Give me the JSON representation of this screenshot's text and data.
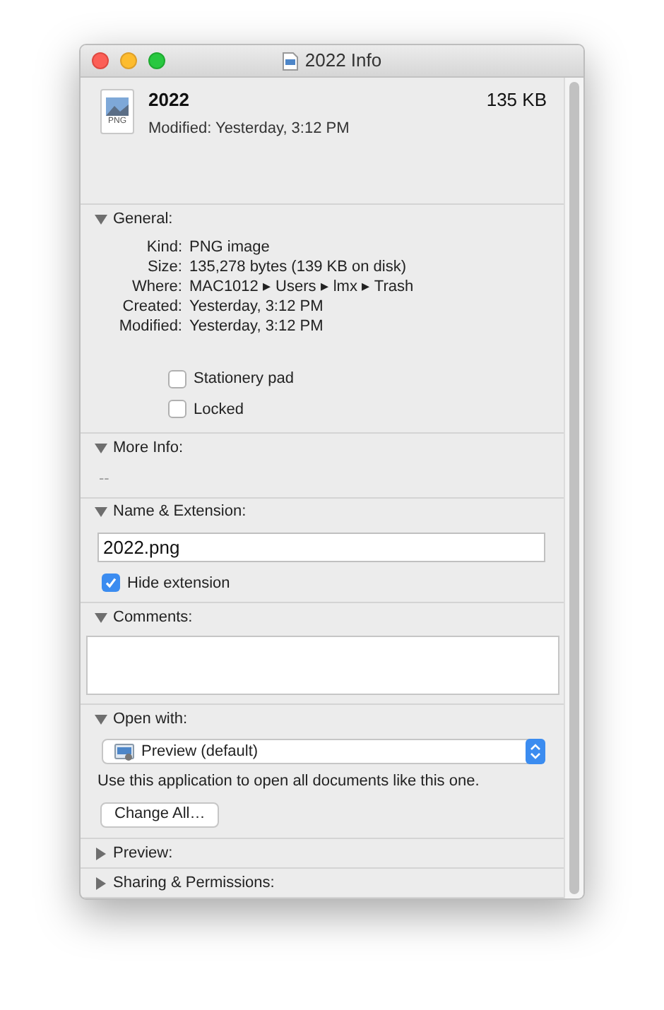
{
  "window": {
    "title": "2022 Info"
  },
  "header": {
    "icon_label": "PNG",
    "name": "2022",
    "size": "135 KB",
    "modified": "Modified: Yesterday, 3:12 PM"
  },
  "sections": [
    {
      "kind": "general",
      "title": "General:",
      "expanded": true,
      "fields": [
        {
          "label": "Kind:",
          "value": "PNG image"
        },
        {
          "label": "Size:",
          "value": "135,278 bytes (139 KB on disk)"
        },
        {
          "label": "Where:",
          "value": "MAC1012 ▸ Users ▸ lmx ▸ Trash"
        },
        {
          "label": "Created:",
          "value": "Yesterday, 3:12 PM"
        },
        {
          "label": "Modified:",
          "value": "Yesterday, 3:12 PM"
        }
      ],
      "checkboxes": [
        {
          "label": "Stationery pad",
          "checked": false
        },
        {
          "label": "Locked",
          "checked": false
        }
      ]
    },
    {
      "kind": "more_info",
      "title": "More Info:",
      "expanded": true,
      "value": "--"
    },
    {
      "kind": "name",
      "title": "Name & Extension:",
      "expanded": true,
      "value": "2022.png",
      "checkbox": {
        "label": "Hide extension",
        "checked": true
      }
    },
    {
      "kind": "comments",
      "title": "Comments:",
      "expanded": true
    },
    {
      "kind": "open_with",
      "title": "Open with:",
      "expanded": true,
      "app": "Preview (default)",
      "note": "Use this application to open all documents like this one.",
      "button": "Change All…"
    },
    {
      "title": "Preview:",
      "expanded": false
    },
    {
      "title": "Sharing & Permissions:",
      "expanded": false
    }
  ]
}
